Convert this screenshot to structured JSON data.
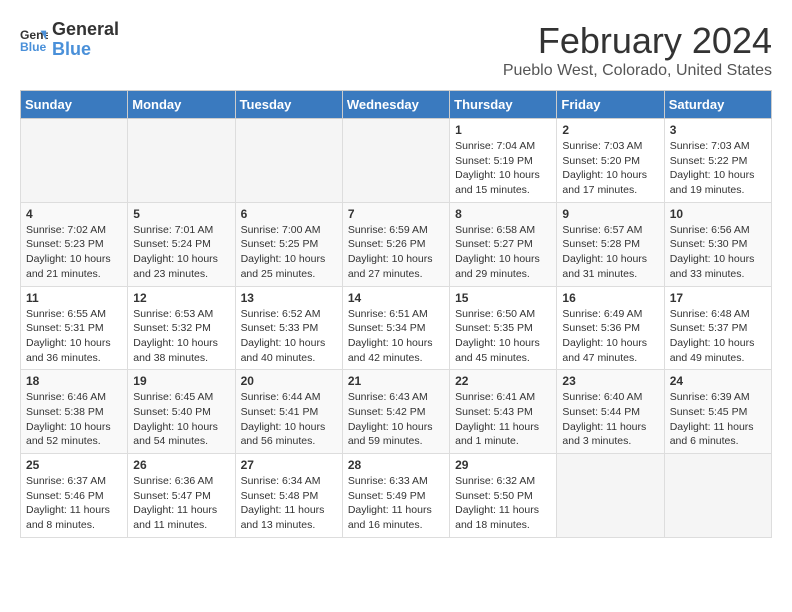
{
  "header": {
    "logo_line1": "General",
    "logo_line2": "Blue",
    "title": "February 2024",
    "subtitle": "Pueblo West, Colorado, United States"
  },
  "days_of_week": [
    "Sunday",
    "Monday",
    "Tuesday",
    "Wednesday",
    "Thursday",
    "Friday",
    "Saturday"
  ],
  "weeks": [
    [
      {
        "num": "",
        "info": ""
      },
      {
        "num": "",
        "info": ""
      },
      {
        "num": "",
        "info": ""
      },
      {
        "num": "",
        "info": ""
      },
      {
        "num": "1",
        "info": "Sunrise: 7:04 AM\nSunset: 5:19 PM\nDaylight: 10 hours\nand 15 minutes."
      },
      {
        "num": "2",
        "info": "Sunrise: 7:03 AM\nSunset: 5:20 PM\nDaylight: 10 hours\nand 17 minutes."
      },
      {
        "num": "3",
        "info": "Sunrise: 7:03 AM\nSunset: 5:22 PM\nDaylight: 10 hours\nand 19 minutes."
      }
    ],
    [
      {
        "num": "4",
        "info": "Sunrise: 7:02 AM\nSunset: 5:23 PM\nDaylight: 10 hours\nand 21 minutes."
      },
      {
        "num": "5",
        "info": "Sunrise: 7:01 AM\nSunset: 5:24 PM\nDaylight: 10 hours\nand 23 minutes."
      },
      {
        "num": "6",
        "info": "Sunrise: 7:00 AM\nSunset: 5:25 PM\nDaylight: 10 hours\nand 25 minutes."
      },
      {
        "num": "7",
        "info": "Sunrise: 6:59 AM\nSunset: 5:26 PM\nDaylight: 10 hours\nand 27 minutes."
      },
      {
        "num": "8",
        "info": "Sunrise: 6:58 AM\nSunset: 5:27 PM\nDaylight: 10 hours\nand 29 minutes."
      },
      {
        "num": "9",
        "info": "Sunrise: 6:57 AM\nSunset: 5:28 PM\nDaylight: 10 hours\nand 31 minutes."
      },
      {
        "num": "10",
        "info": "Sunrise: 6:56 AM\nSunset: 5:30 PM\nDaylight: 10 hours\nand 33 minutes."
      }
    ],
    [
      {
        "num": "11",
        "info": "Sunrise: 6:55 AM\nSunset: 5:31 PM\nDaylight: 10 hours\nand 36 minutes."
      },
      {
        "num": "12",
        "info": "Sunrise: 6:53 AM\nSunset: 5:32 PM\nDaylight: 10 hours\nand 38 minutes."
      },
      {
        "num": "13",
        "info": "Sunrise: 6:52 AM\nSunset: 5:33 PM\nDaylight: 10 hours\nand 40 minutes."
      },
      {
        "num": "14",
        "info": "Sunrise: 6:51 AM\nSunset: 5:34 PM\nDaylight: 10 hours\nand 42 minutes."
      },
      {
        "num": "15",
        "info": "Sunrise: 6:50 AM\nSunset: 5:35 PM\nDaylight: 10 hours\nand 45 minutes."
      },
      {
        "num": "16",
        "info": "Sunrise: 6:49 AM\nSunset: 5:36 PM\nDaylight: 10 hours\nand 47 minutes."
      },
      {
        "num": "17",
        "info": "Sunrise: 6:48 AM\nSunset: 5:37 PM\nDaylight: 10 hours\nand 49 minutes."
      }
    ],
    [
      {
        "num": "18",
        "info": "Sunrise: 6:46 AM\nSunset: 5:38 PM\nDaylight: 10 hours\nand 52 minutes."
      },
      {
        "num": "19",
        "info": "Sunrise: 6:45 AM\nSunset: 5:40 PM\nDaylight: 10 hours\nand 54 minutes."
      },
      {
        "num": "20",
        "info": "Sunrise: 6:44 AM\nSunset: 5:41 PM\nDaylight: 10 hours\nand 56 minutes."
      },
      {
        "num": "21",
        "info": "Sunrise: 6:43 AM\nSunset: 5:42 PM\nDaylight: 10 hours\nand 59 minutes."
      },
      {
        "num": "22",
        "info": "Sunrise: 6:41 AM\nSunset: 5:43 PM\nDaylight: 11 hours\nand 1 minute."
      },
      {
        "num": "23",
        "info": "Sunrise: 6:40 AM\nSunset: 5:44 PM\nDaylight: 11 hours\nand 3 minutes."
      },
      {
        "num": "24",
        "info": "Sunrise: 6:39 AM\nSunset: 5:45 PM\nDaylight: 11 hours\nand 6 minutes."
      }
    ],
    [
      {
        "num": "25",
        "info": "Sunrise: 6:37 AM\nSunset: 5:46 PM\nDaylight: 11 hours\nand 8 minutes."
      },
      {
        "num": "26",
        "info": "Sunrise: 6:36 AM\nSunset: 5:47 PM\nDaylight: 11 hours\nand 11 minutes."
      },
      {
        "num": "27",
        "info": "Sunrise: 6:34 AM\nSunset: 5:48 PM\nDaylight: 11 hours\nand 13 minutes."
      },
      {
        "num": "28",
        "info": "Sunrise: 6:33 AM\nSunset: 5:49 PM\nDaylight: 11 hours\nand 16 minutes."
      },
      {
        "num": "29",
        "info": "Sunrise: 6:32 AM\nSunset: 5:50 PM\nDaylight: 11 hours\nand 18 minutes."
      },
      {
        "num": "",
        "info": ""
      },
      {
        "num": "",
        "info": ""
      }
    ]
  ]
}
